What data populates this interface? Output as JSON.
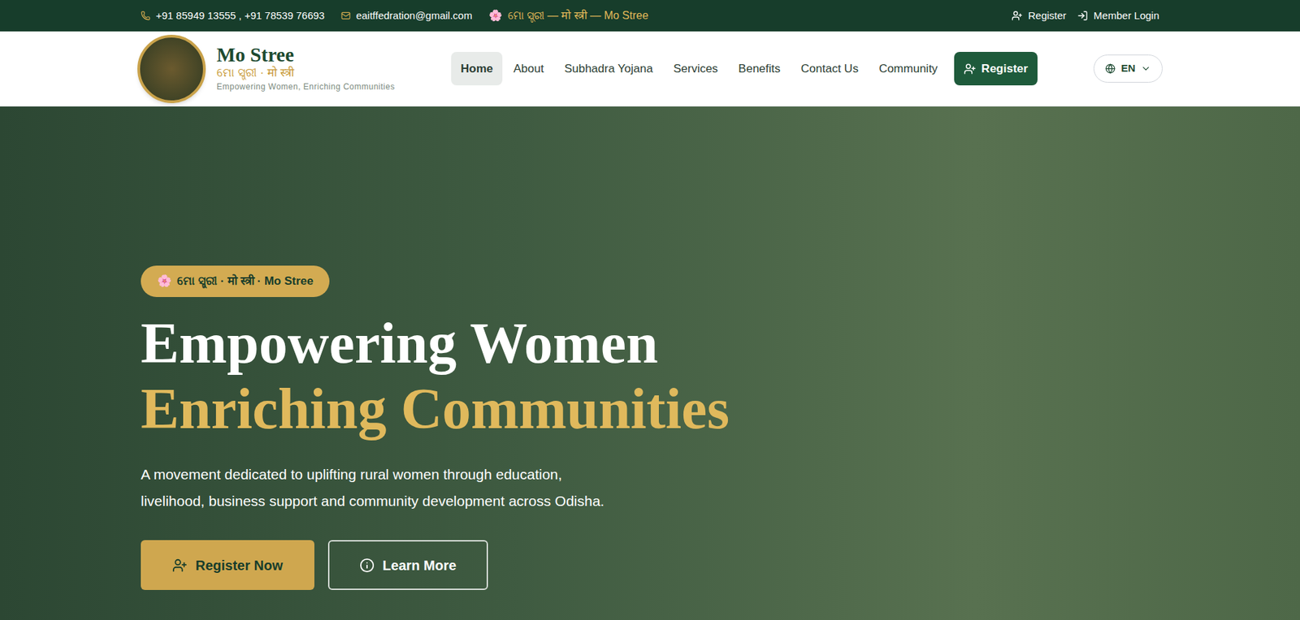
{
  "topbar": {
    "phones": "+91 85949 13555 , +91 78539 76693",
    "email": "eaitffedration@gmail.com",
    "tagline_icon": "🌸",
    "tagline": "ମୋ ସ୍ତ୍ରୀ — मो स्त्री — Mo Stree",
    "links": [
      "Register",
      "Member Login"
    ]
  },
  "brand": {
    "name": "Mo Stree",
    "subtitle": "ମୋ ସ୍ତ୍ରୀ · मो स्त्री",
    "tagline": "Empowering Women, Enriching Communities"
  },
  "nav": [
    {
      "label": "Home",
      "selected": true
    },
    {
      "label": "About",
      "selected": false
    },
    {
      "label": "Subhadra Yojana",
      "selected": false
    },
    {
      "label": "Services",
      "selected": false
    },
    {
      "label": "Benefits",
      "selected": false
    },
    {
      "label": "Contact Us",
      "selected": false
    },
    {
      "label": "Community",
      "selected": false
    }
  ],
  "nav_button": "Register",
  "language": "EN",
  "hero": {
    "badge_icon": "🌸",
    "badge": "ମୋ ସ୍ତ୍ରୀ · मो स्त्री · Mo Stree",
    "title_line1": "Empowering Women",
    "title_line2": "Enriching Communities",
    "description": "A movement dedicated to uplifting rural women through education, livelihood, business support and community development across Odisha.",
    "buttons": [
      {
        "label": "Register Now",
        "kind": "primary"
      },
      {
        "label": "Learn More",
        "kind": "outline"
      }
    ]
  }
}
